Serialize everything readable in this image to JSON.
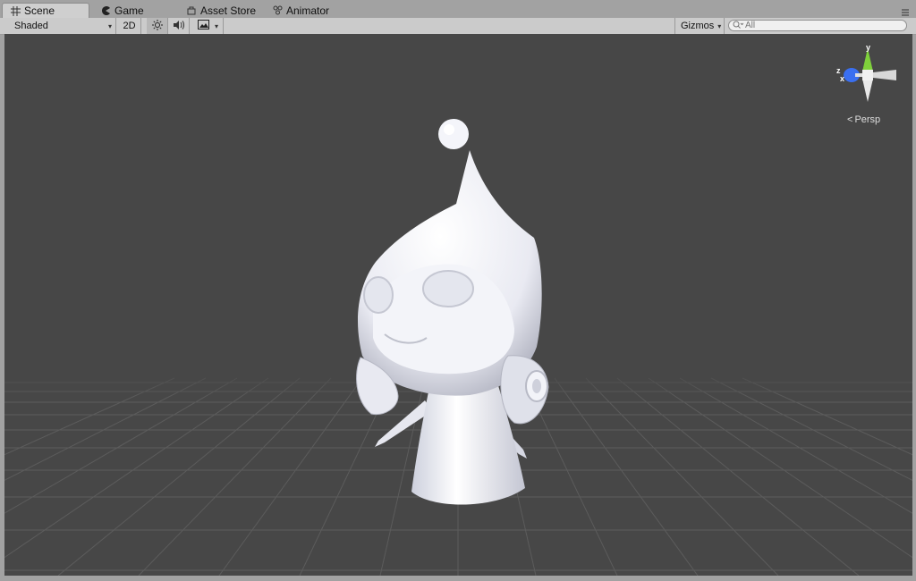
{
  "tabs": [
    {
      "label": "Scene",
      "icon": "grid-icon",
      "active": true
    },
    {
      "label": "Game",
      "icon": "pacman-icon",
      "active": false
    },
    {
      "label": "Asset Store",
      "icon": "store-icon",
      "active": false
    },
    {
      "label": "Animator",
      "icon": "animator-icon",
      "active": false
    }
  ],
  "toolbar": {
    "shading_mode": "Shaded",
    "mode_2d": "2D",
    "lighting_icon": "sun-icon",
    "audio_icon": "speaker-icon",
    "effects_icon": "image-icon",
    "gizmos_label": "Gizmos",
    "search_placeholder": "All"
  },
  "viewport": {
    "projection_label": "Persp",
    "axis_y": "y",
    "axis_z": "z",
    "axis_x": "x",
    "colors": {
      "background": "#474747",
      "grid": "#5a5a5a",
      "axis_y": "#7fd13b",
      "axis_z": "#3a6ff0"
    }
  }
}
